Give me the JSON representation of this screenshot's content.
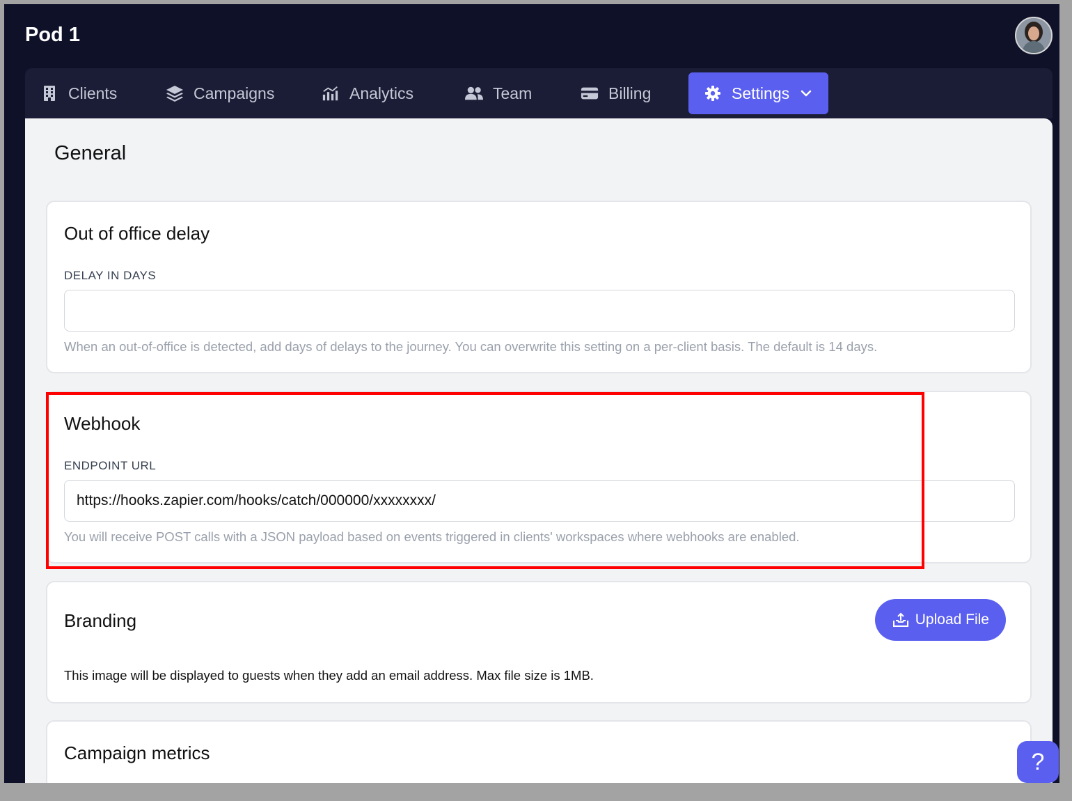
{
  "app": {
    "title": "Pod 1"
  },
  "user": {
    "avatar_alt": "User avatar"
  },
  "nav": {
    "items": [
      {
        "label": "Clients",
        "icon": "building-icon"
      },
      {
        "label": "Campaigns",
        "icon": "layers-icon"
      },
      {
        "label": "Analytics",
        "icon": "bar-chart-icon"
      },
      {
        "label": "Team",
        "icon": "users-icon"
      },
      {
        "label": "Billing",
        "icon": "credit-card-icon"
      },
      {
        "label": "Settings",
        "icon": "gear-icon",
        "active": true
      }
    ]
  },
  "page": {
    "title": "General"
  },
  "out_of_office": {
    "title": "Out of office delay",
    "field_label": "DELAY IN DAYS",
    "value": "",
    "help": "When an out-of-office is detected, add days of delays to the journey. You can overwrite this setting on a per-client basis. The default is 14 days."
  },
  "webhook": {
    "title": "Webhook",
    "field_label": "ENDPOINT URL",
    "value": "https://hooks.zapier.com/hooks/catch/000000/xxxxxxxx/",
    "help": "You will receive POST calls with a JSON payload based on events triggered in clients' workspaces where webhooks are enabled."
  },
  "branding": {
    "title": "Branding",
    "upload_label": "Upload File",
    "description": "This image will be displayed to guests when they add an email address. Max file size is 1MB."
  },
  "campaign_metrics": {
    "title": "Campaign metrics"
  },
  "help_button": {
    "label": "?"
  },
  "colors": {
    "accent": "#5a5ff0",
    "background_dark": "#0f1129",
    "navbar": "#1b1d36",
    "content_bg": "#f2f3f5",
    "highlight": "#ff0000"
  }
}
